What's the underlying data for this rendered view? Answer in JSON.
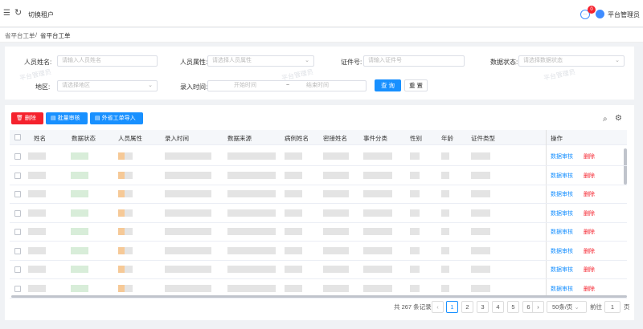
{
  "topbar": {
    "tenant_label": "切换租户",
    "notification_count": "0",
    "username": "平台管理员"
  },
  "breadcrumb": {
    "parent": "省平台工单",
    "separator": "/",
    "current": "省平台工单"
  },
  "search": {
    "name_label": "人员姓名:",
    "name_placeholder": "请输入人员姓名",
    "attr_label": "人员属性:",
    "attr_placeholder": "请选择人员属性",
    "id_label": "证件号:",
    "id_placeholder": "请输入证件号",
    "status_label": "数据状态:",
    "status_placeholder": "请选择数据状态",
    "region_label": "地区:",
    "region_placeholder": "请选择地区",
    "time_label": "录入时间:",
    "time_start": "开始时间",
    "time_sep": "~",
    "time_end": "结束时间",
    "query_label": "查 询",
    "reset_label": "重 置"
  },
  "watermark": "平台管理员",
  "toolbar": {
    "delete_label": "删除",
    "batch_label": "批量审核",
    "import_label": "外省工单导入"
  },
  "table": {
    "columns": [
      "姓名",
      "数据状态",
      "人员属性",
      "录入时间",
      "数据来源",
      "病例姓名",
      "密接姓名",
      "事件分类",
      "性别",
      "年龄",
      "证件类型",
      "操作"
    ],
    "actions": {
      "audit": "数据审核",
      "delete": "删除"
    },
    "row_count": 8
  },
  "pagination": {
    "total": "共 267 条记录",
    "pages": [
      "1",
      "2",
      "3",
      "4",
      "5",
      "6"
    ],
    "current": "1",
    "page_size": "50条/页",
    "goto_label": "前往",
    "goto_value": "1",
    "page_unit": "页"
  },
  "colors": {
    "primary": "#1890ff",
    "danger": "#f5222d"
  }
}
